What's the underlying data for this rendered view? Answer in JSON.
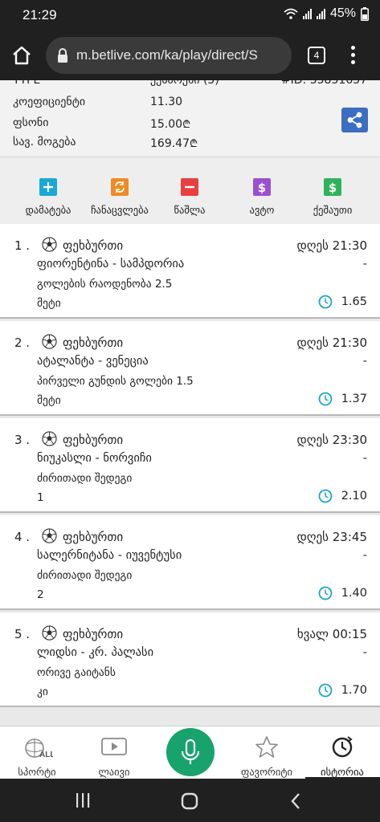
{
  "status_bar": {
    "time": "21:29",
    "battery": "45%"
  },
  "browser": {
    "url": "m.betlive.com/ka/play/direct/S",
    "tab_count": "4"
  },
  "summary": {
    "clipped_left": "TYPE",
    "clipped_mid": "ექსპრესი (5)",
    "clipped_right": "#ID: 55851637",
    "rows": [
      {
        "label": "კოეფიციენტი",
        "value": "11.30",
        "currency": ""
      },
      {
        "label": "ფსონი",
        "value": "15.00",
        "currency": "₾"
      },
      {
        "label": "სავ. მოგება",
        "value": "169.47",
        "currency": "₾"
      }
    ]
  },
  "actions": [
    {
      "label": "დამატება",
      "icon": "plus-icon",
      "color": "#1ba8d6"
    },
    {
      "label": "ჩანაცვლება",
      "icon": "swap-icon",
      "color": "#f08a24"
    },
    {
      "label": "წაშლა",
      "icon": "minus-icon",
      "color": "#e84040"
    },
    {
      "label": "ავტო",
      "icon": "dollar-icon",
      "color": "#9b4fd1"
    },
    {
      "label": "ქეშაუთი",
      "icon": "dollar-icon",
      "color": "#2fb35a"
    }
  ],
  "bets": [
    {
      "num": "1 .",
      "sport": "ფეხბურთი",
      "time": "დღეს 21:30",
      "teams": "ფიორენტინა - სამპდორია",
      "dash": "-",
      "market": "გოლების რაოდენობა 2.5",
      "pick": "მეტი",
      "odds": "1.65"
    },
    {
      "num": "2 .",
      "sport": "ფეხბურთი",
      "time": "დღეს 21:30",
      "teams": "ატალანტა - ვენეცია",
      "dash": "-",
      "market": "პირველი გუნდის გოლები 1.5",
      "pick": "მეტი",
      "odds": "1.37"
    },
    {
      "num": "3 .",
      "sport": "ფეხბურთი",
      "time": "დღეს 23:30",
      "teams": "ნიუკასლი - ნორვიჩი",
      "dash": "-",
      "market": "ძირითადი შედეგი",
      "pick": "1",
      "odds": "2.10"
    },
    {
      "num": "4 .",
      "sport": "ფეხბურთი",
      "time": "დღეს 23:45",
      "teams": "სალერნიტანა - იუვენტუსი",
      "dash": "-",
      "market": "ძირითადი შედეგი",
      "pick": "2",
      "odds": "1.40"
    },
    {
      "num": "5 .",
      "sport": "ფეხბურთი",
      "time": "ხვალ 00:15",
      "teams": "ლიდსი - კრ. პალასი",
      "dash": "-",
      "market": "ორივე გაიტანს",
      "pick": "კი",
      "odds": "1.70"
    }
  ],
  "bottom_nav": [
    {
      "label": "სპორტი",
      "icon": "sports-ball-icon",
      "icon_text": "ALL"
    },
    {
      "label": "ლაივი",
      "icon": "play-icon"
    },
    {
      "label": "ფავორიტი",
      "icon": "star-icon"
    },
    {
      "label": "ისტორია",
      "icon": "history-icon",
      "active": true
    }
  ],
  "colors": {
    "accent_green": "#17a36b",
    "share_blue": "#3b6ec3",
    "clock_teal": "#1ba8c6"
  }
}
